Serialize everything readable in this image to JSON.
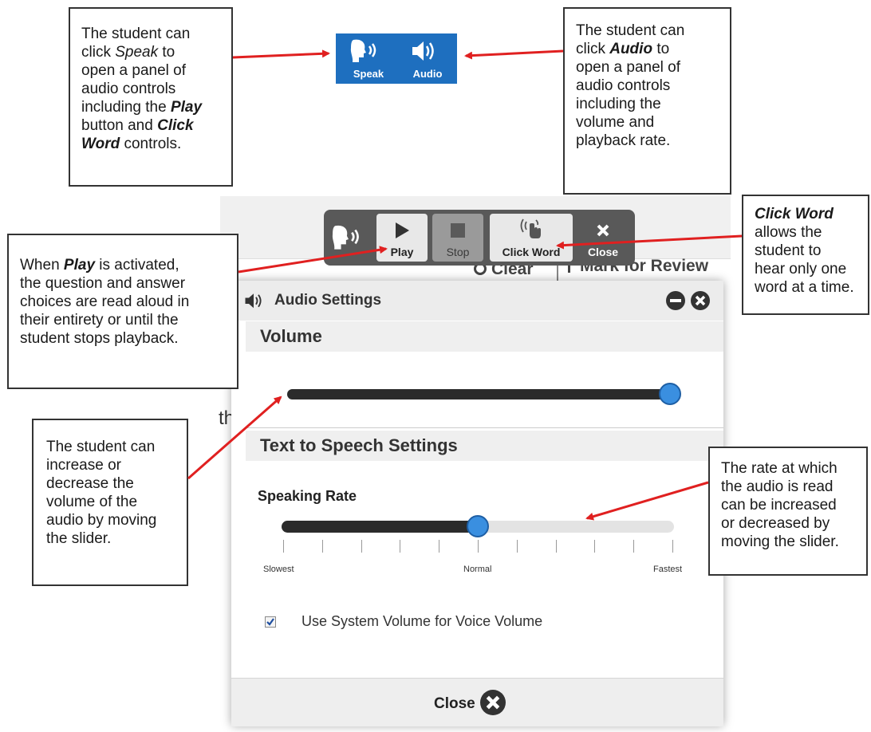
{
  "callouts": {
    "speak": [
      {
        "t": "The student can\nclick ",
        "s": "n"
      },
      {
        "t": "Speak",
        "s": "it"
      },
      {
        "t": " to\nopen a panel of\naudio controls\nincluding the ",
        "s": "n"
      },
      {
        "t": "Play",
        "s": "bi"
      },
      {
        "t": "\nbutton and ",
        "s": "n"
      },
      {
        "t": "Click\nWord",
        "s": "bi"
      },
      {
        "t": " controls.",
        "s": "n"
      }
    ],
    "audio": [
      {
        "t": "The student can\nclick ",
        "s": "n"
      },
      {
        "t": "Audio",
        "s": "bi"
      },
      {
        "t": " to\nopen a panel of\naudio controls\nincluding the\nvolume and\nplayback rate.",
        "s": "n"
      }
    ],
    "play": [
      {
        "t": "When ",
        "s": "n"
      },
      {
        "t": "Play",
        "s": "bi"
      },
      {
        "t": " is activated,\nthe question and answer\nchoices are read aloud in\ntheir entirety or until the\nstudent stops playback.",
        "s": "n"
      }
    ],
    "click_word": [
      {
        "t": "Click Word",
        "s": "bi"
      },
      {
        "t": "\nallows the\nstudent to\nhear only one\nword at a time.",
        "s": "n"
      }
    ],
    "volume": [
      {
        "t": "The student can\nincrease or\ndecrease the\nvolume of the\naudio by moving\nthe slider.",
        "s": "n"
      }
    ],
    "rate": [
      {
        "t": "The rate at which\nthe audio is read\ncan be increased\nor decreased by\nmoving the slider.",
        "s": "n"
      }
    ]
  },
  "top_toolbar": {
    "speak_label": "Speak",
    "audio_label": "Audio"
  },
  "tts_toolbar": {
    "play_label": "Play",
    "stop_label": "Stop",
    "click_word_label": "Click Word",
    "close_label": "Close"
  },
  "background_page": {
    "clear_label": "Clear",
    "mark_review_label": "Mark for Review",
    "text_fragment": "th"
  },
  "panel": {
    "title": "Audio Settings",
    "volume_heading": "Volume",
    "volume_level": 1.0,
    "tts_heading": "Text to Speech Settings",
    "rate_label": "Speaking Rate",
    "rate_level": 0.5,
    "rate_min_label": "Slowest",
    "rate_mid_label": "Normal",
    "rate_max_label": "Fastest",
    "checkbox_label": "Use System Volume for Voice Volume",
    "checkbox_checked": true,
    "close_label": "Close"
  },
  "colors": {
    "toolbar_blue": "#1e6fbf",
    "arrow_red": "#e02020",
    "slider_dark": "#2b2b2b",
    "slider_knob": "#3a8fe0",
    "tts_bar": "#595959"
  }
}
